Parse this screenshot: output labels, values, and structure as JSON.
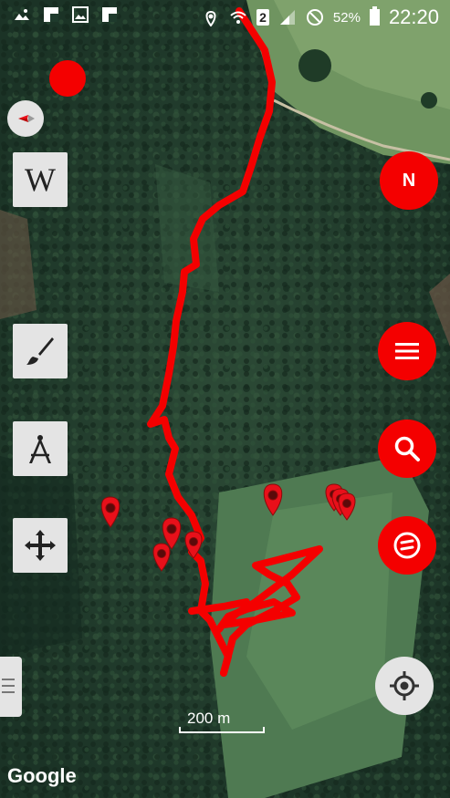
{
  "status_bar": {
    "battery_percent": "52%",
    "sim_slot": "2",
    "time": "22:20",
    "icons": [
      "image-icon",
      "app-icon",
      "image-icon",
      "app-icon",
      "location-icon",
      "wifi-icon",
      "signal-icon",
      "dnd-icon",
      "battery-icon"
    ]
  },
  "toolbar_left": {
    "wikipedia_label": "W",
    "tools": [
      "recording-dot",
      "compass-small",
      "wikipedia-button",
      "brush-icon",
      "compass-tool-icon",
      "move-arrows-icon"
    ]
  },
  "toolbar_right": {
    "north_label": "N",
    "buttons": [
      "north-button",
      "menu-button",
      "search-button",
      "navigation-button",
      "gps-locate-button"
    ]
  },
  "map": {
    "map_type": "satellite",
    "track_color": "#f40000",
    "marker_color": "#e8101a",
    "marker_count": 8,
    "scale_label": "200 m",
    "attribution": "Google"
  },
  "colors": {
    "accent": "#f40000",
    "button_gray": "#e4e4e4"
  }
}
